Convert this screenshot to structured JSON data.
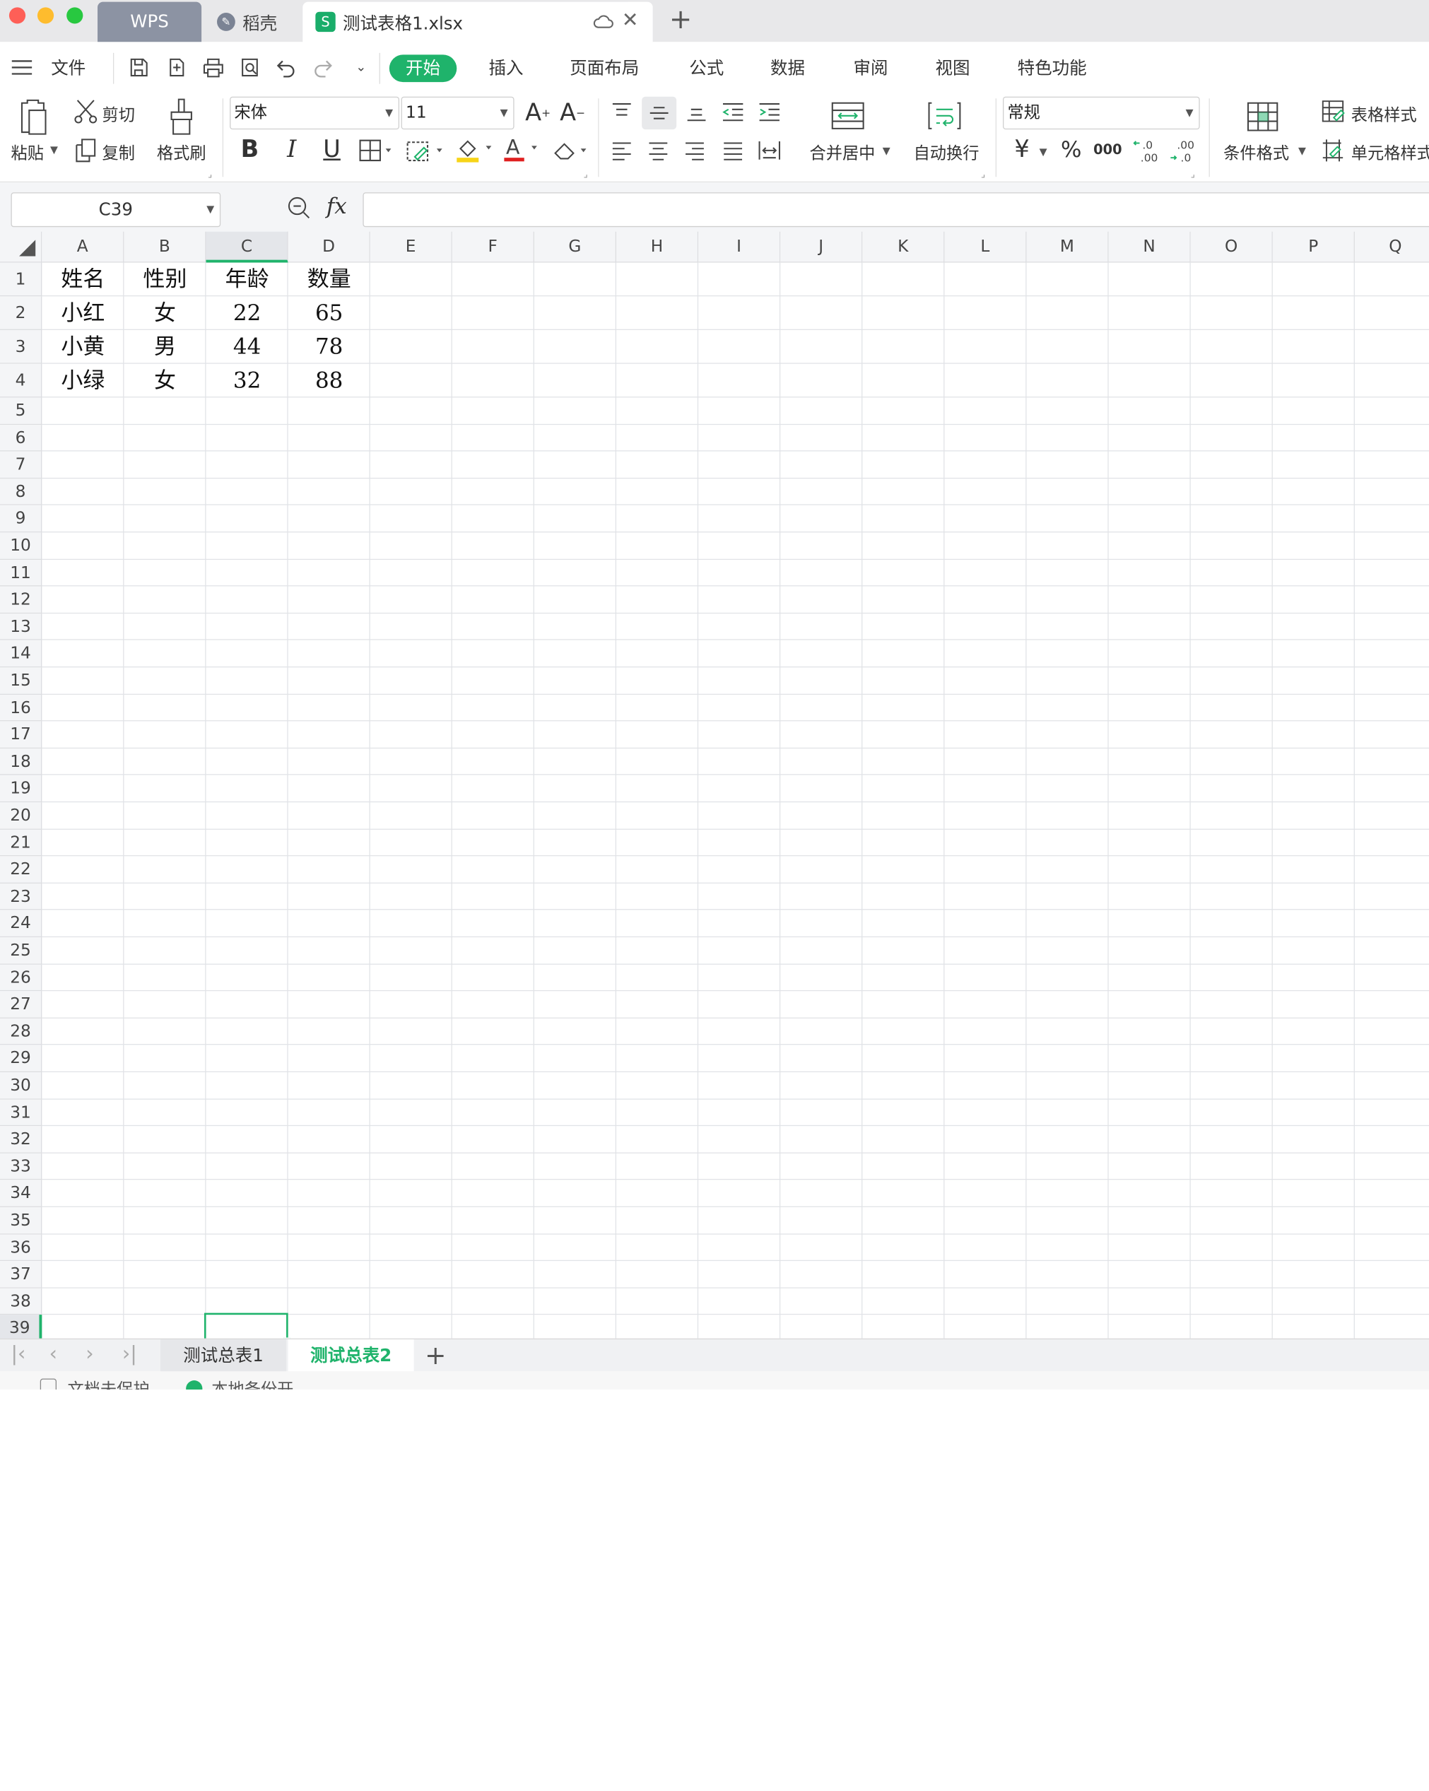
{
  "titlebar": {
    "traffic_lights": {
      "close": "#fe5f57",
      "minimize": "#febc2e",
      "maximize": "#28c840"
    },
    "tabs": [
      {
        "label": "WPS"
      },
      {
        "label": "稻壳"
      },
      {
        "label": "测试表格1.xlsx"
      }
    ],
    "new_tab_label": "+"
  },
  "menu": {
    "file_label": "文件",
    "tabs": [
      "开始",
      "插入",
      "页面布局",
      "公式",
      "数据",
      "审阅",
      "视图",
      "特色功能"
    ],
    "active_tab": "开始",
    "accent": "#1fb36b"
  },
  "ribbon": {
    "paste": "粘贴",
    "cut": "剪切",
    "copy": "复制",
    "format_painter": "格式刷",
    "font_name": "宋体",
    "font_size": "11",
    "merge_center": "合并居中",
    "wrap_text": "自动换行",
    "number_format": "常规",
    "currency_symbol": "¥",
    "percent_symbol": "%",
    "thousands_symbol": "000",
    "conditional_format": "条件格式",
    "table_style": "表格样式",
    "cell_style": "单元格样式",
    "bold": "B",
    "italic": "I",
    "underline": "U"
  },
  "formula_bar": {
    "cell_reference": "C39",
    "fx_label": "fx",
    "formula_value": ""
  },
  "sheet": {
    "columns": [
      "A",
      "B",
      "C",
      "D",
      "E",
      "F",
      "G",
      "H",
      "I",
      "J",
      "K",
      "L",
      "M",
      "N",
      "O",
      "P",
      "Q"
    ],
    "selected_column": "C",
    "selected_row": 39,
    "rows": [
      [
        "姓名",
        "性别",
        "年龄",
        "数量"
      ],
      [
        "小红",
        "女",
        "22",
        "65"
      ],
      [
        "小黄",
        "男",
        "44",
        "78"
      ],
      [
        "小绿",
        "女",
        "32",
        "88"
      ]
    ],
    "row_count": 39
  },
  "sheet_tabs": {
    "tabs": [
      "测试总表1",
      "测试总表2"
    ],
    "active": "测试总表2",
    "add_label": "+"
  },
  "status_bar": {
    "protect_label": "文档未保护",
    "backup_label": "本地备份开"
  }
}
